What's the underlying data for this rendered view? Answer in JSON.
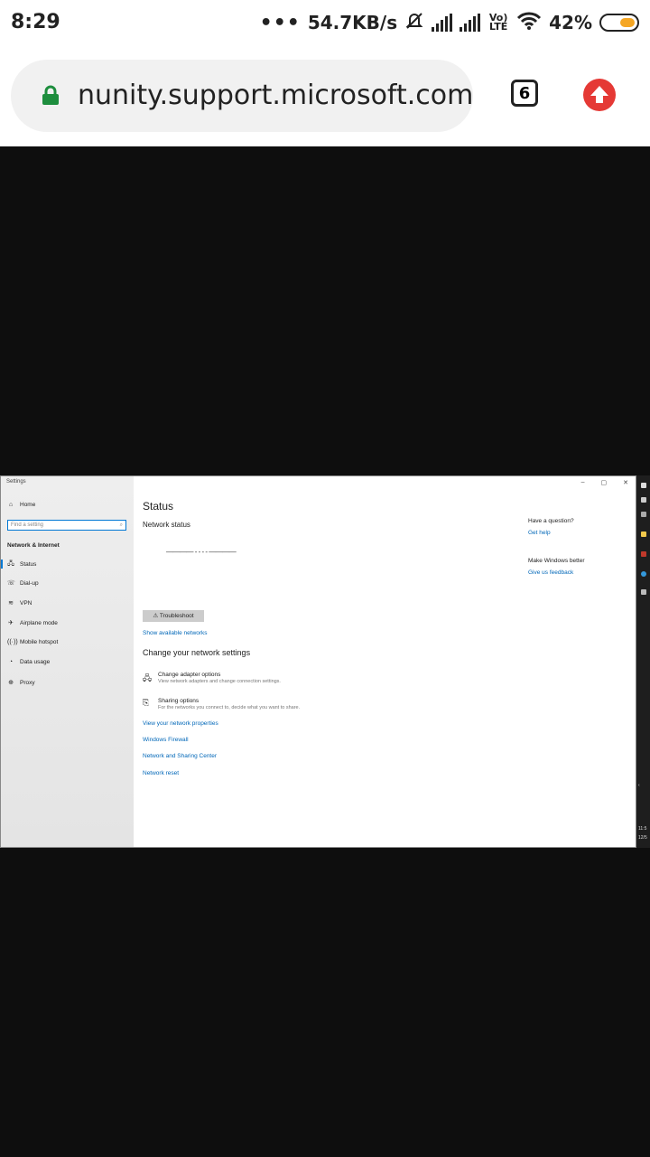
{
  "status_bar": {
    "time": "8:29",
    "dots": "•••",
    "speed": "54.7KB/s",
    "volte_label": "Vo) LTE",
    "battery_percent": "42%",
    "battery_level": 0.42
  },
  "browser": {
    "url": "nunity.support.microsoft.com",
    "tab_count": "6"
  },
  "settings_window": {
    "app_title": "Settings",
    "window_controls": [
      "–",
      "▢",
      "✕"
    ],
    "sidebar": {
      "home": "Home",
      "search_placeholder": "Find a setting",
      "section": "Network & Internet",
      "items": [
        {
          "label": "Status",
          "icon": "status-icon"
        },
        {
          "label": "Dial-up",
          "icon": "dialup-icon"
        },
        {
          "label": "VPN",
          "icon": "vpn-icon"
        },
        {
          "label": "Airplane mode",
          "icon": "airplane-icon"
        },
        {
          "label": "Mobile hotspot",
          "icon": "hotspot-icon"
        },
        {
          "label": "Data usage",
          "icon": "data-usage-icon"
        },
        {
          "label": "Proxy",
          "icon": "proxy-icon"
        }
      ]
    },
    "main": {
      "title": "Status",
      "network_status_label": "Network status",
      "status_diagram": "———— - - - - ————",
      "troubleshoot": "Troubleshoot",
      "show_networks": "Show available networks",
      "change_heading": "Change your network settings",
      "options": [
        {
          "title": "Change adapter options",
          "subtitle": "View network adapters and change connection settings."
        },
        {
          "title": "Sharing options",
          "subtitle": "For the networks you connect to, decide what you want to share."
        }
      ],
      "links": [
        "View your network properties",
        "Windows Firewall",
        "Network and Sharing Center",
        "Network reset"
      ]
    },
    "aside": {
      "question": "Have a question?",
      "get_help": "Get help",
      "better": "Make Windows better",
      "feedback": "Give us feedback"
    }
  },
  "taskbar_strip": {
    "clock": "11:5",
    "date": "12/5"
  },
  "colors": {
    "accent": "#0067b8",
    "lock_green": "#1e8e3e",
    "update_red": "#e53935",
    "battery": "#f5a623"
  }
}
